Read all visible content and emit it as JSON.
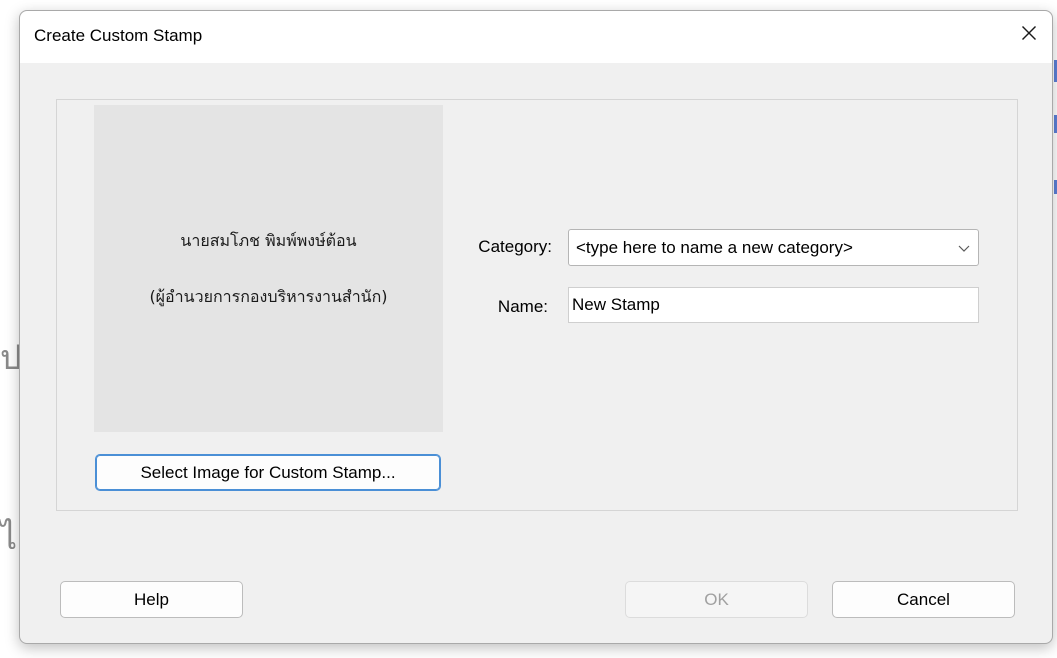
{
  "dialog": {
    "title": "Create Custom Stamp",
    "close_icon": "close-icon"
  },
  "preview": {
    "stamp_line_1": "นายสมโภช พิมพ์พงษ์ต้อน",
    "stamp_line_2": "(ผู้อำนวยการกองบริหารงานสำนัก)"
  },
  "buttons": {
    "select_image": "Select Image for Custom Stamp...",
    "help": "Help",
    "ok": "OK",
    "cancel": "Cancel"
  },
  "form": {
    "category_label": "Category:",
    "category_value": "<type here to name a new category>",
    "name_label": "Name:",
    "name_value": "New Stamp"
  },
  "background": {
    "fragment_1": "ป",
    "fragment_2": "ไ"
  },
  "colors": {
    "dialog_bg": "#f0f0f0",
    "preview_bg": "#e4e4e4",
    "focus_border": "#4a8fd6",
    "disabled_text": "#a0a0a0"
  }
}
